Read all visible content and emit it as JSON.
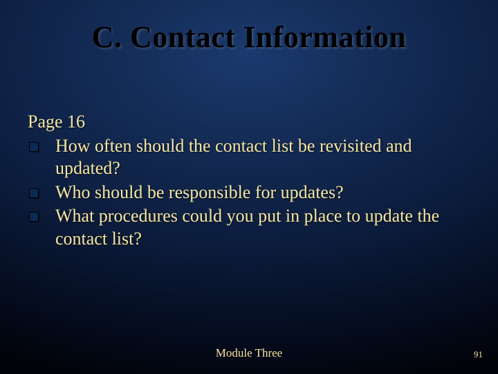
{
  "title": "C. Contact Information",
  "page_ref": "Page 16",
  "bullets": [
    "How often should the contact list be revisited and updated?",
    "Who should be responsible for updates?",
    "What procedures could you put in place to update the contact list?"
  ],
  "footer_center": "Module Three",
  "footer_right": "91"
}
